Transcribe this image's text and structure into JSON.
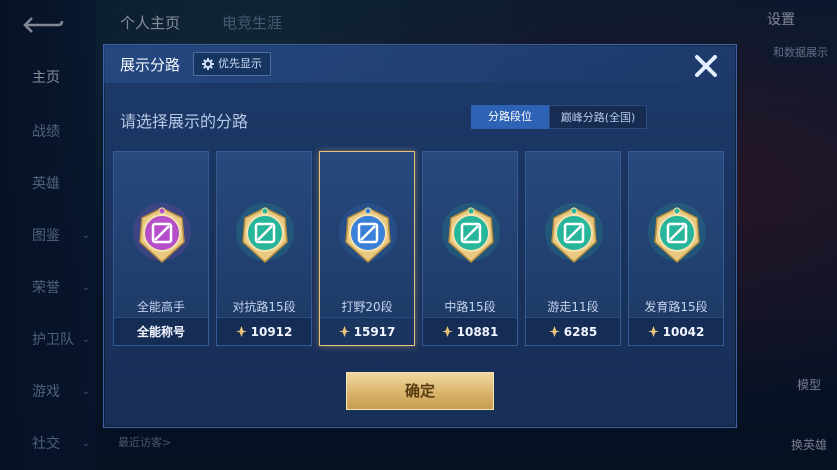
{
  "background": {
    "nav": [
      {
        "label": "主页",
        "active": true,
        "chevron": false
      },
      {
        "label": "战绩",
        "active": false,
        "chevron": false
      },
      {
        "label": "英雄",
        "active": false,
        "chevron": false
      },
      {
        "label": "图鉴",
        "active": false,
        "chevron": true
      },
      {
        "label": "荣誉",
        "active": false,
        "chevron": true
      },
      {
        "label": "护卫队",
        "active": false,
        "chevron": true
      },
      {
        "label": "游戏",
        "active": false,
        "chevron": true
      },
      {
        "label": "社交",
        "active": false,
        "chevron": true
      }
    ],
    "tabs": [
      "个人主页",
      "电竞生涯"
    ],
    "settings_label": "设置",
    "side_chip": "和数据展示",
    "bottom_left": "最近访客>",
    "right_buttons": [
      "模型",
      "换英雄"
    ]
  },
  "modal": {
    "title": "展示分路",
    "priority_label": "优先显示",
    "subtitle": "请选择展示的分路",
    "segments": {
      "active": "分路段位",
      "inactive": "巅峰分路(全国)"
    },
    "confirm_label": "确定",
    "cards": [
      {
        "name": "全能高手",
        "footer": "全能称号",
        "score": null,
        "emblem": "all-round-emblem-icon",
        "color": "#b44fc9",
        "selected": false
      },
      {
        "name": "对抗路15段",
        "footer": null,
        "score": "10912",
        "emblem": "clash-lane-emblem-icon",
        "color": "#27b59b",
        "selected": false
      },
      {
        "name": "打野20段",
        "footer": null,
        "score": "15917",
        "emblem": "jungle-emblem-icon",
        "color": "#3a7fd8",
        "selected": true
      },
      {
        "name": "中路15段",
        "footer": null,
        "score": "10881",
        "emblem": "mid-lane-emblem-icon",
        "color": "#27b59b",
        "selected": false
      },
      {
        "name": "游走11段",
        "footer": null,
        "score": "6285",
        "emblem": "roam-emblem-icon",
        "color": "#27b59b",
        "selected": false
      },
      {
        "name": "发育路15段",
        "footer": null,
        "score": "10042",
        "emblem": "farm-lane-emblem-icon",
        "color": "#27b59b",
        "selected": false
      }
    ]
  },
  "colors": {
    "accent_gold": "#e8c27a",
    "accent_blue": "#2e62b4",
    "teal": "#27b59b",
    "purple": "#b44fc9"
  }
}
